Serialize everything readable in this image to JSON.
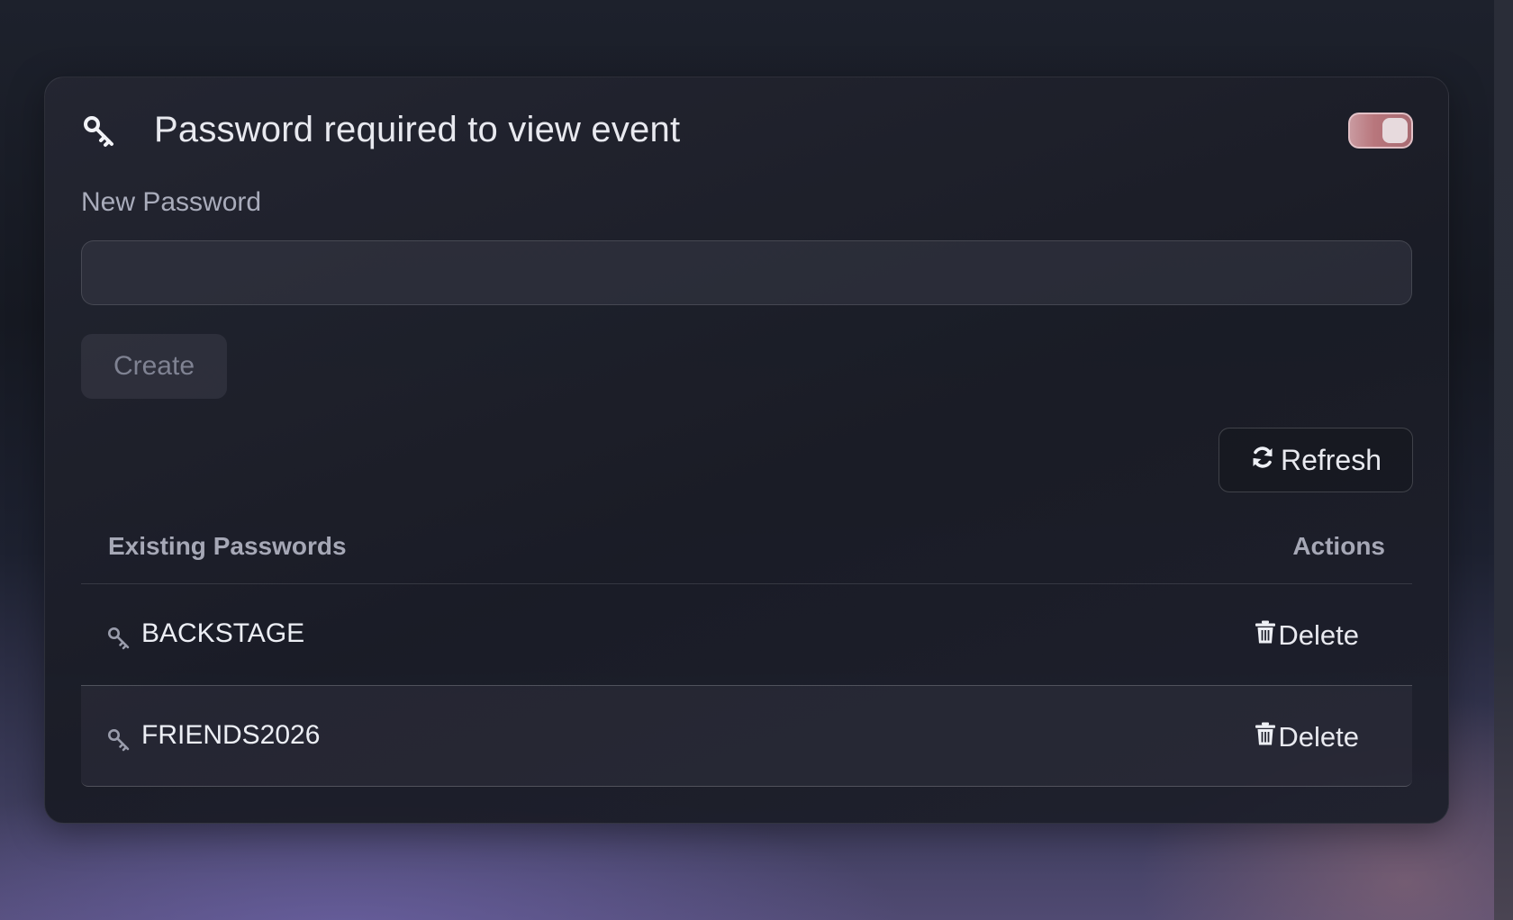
{
  "header": {
    "title": "Password required to view event",
    "icon": "key-icon",
    "toggle_on": true,
    "toggle_color": "#b8767c"
  },
  "form": {
    "label": "New Password",
    "input_value": "",
    "create_label": "Create"
  },
  "toolbar": {
    "refresh_label": "Refresh",
    "refresh_icon": "refresh-icon"
  },
  "table": {
    "columns": [
      "Existing Passwords",
      "Actions"
    ],
    "rows": [
      {
        "name": "BACKSTAGE",
        "action": "Delete",
        "icon": "key-icon"
      },
      {
        "name": "FRIENDS2026",
        "action": "Delete",
        "icon": "key-icon"
      }
    ]
  }
}
